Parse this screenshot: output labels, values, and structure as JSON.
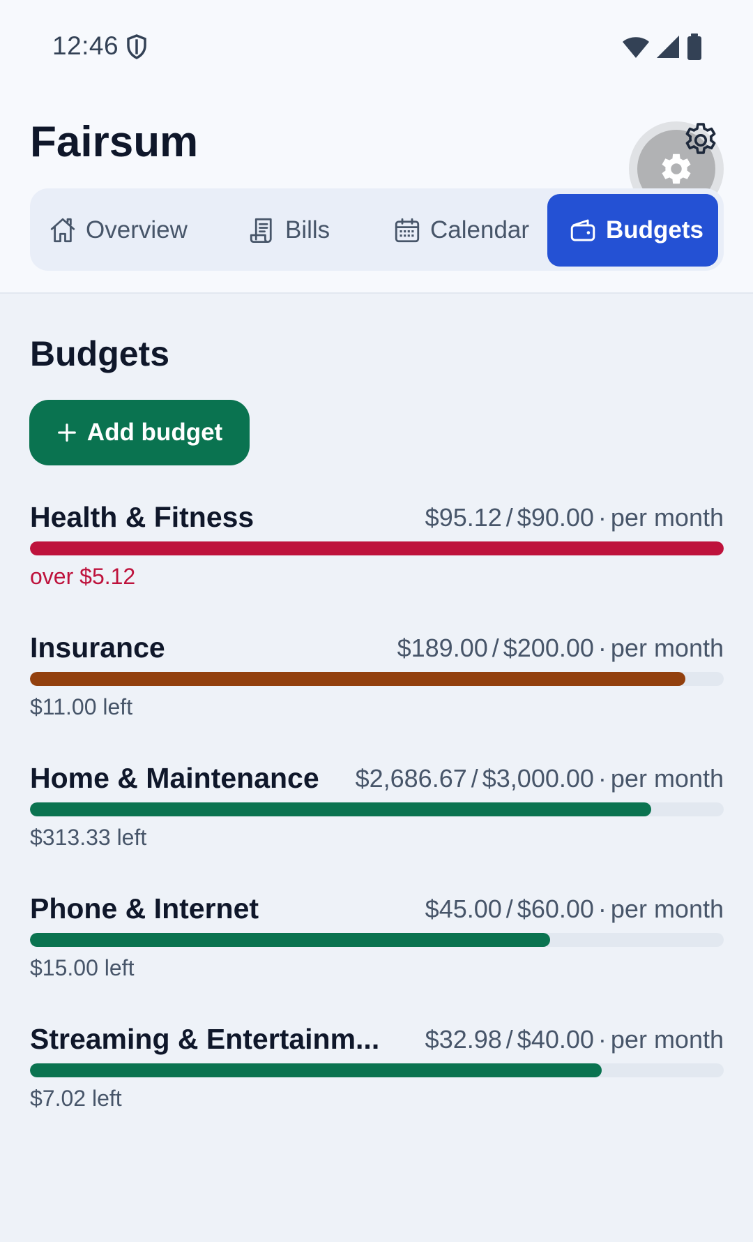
{
  "status_bar": {
    "time": "12:46"
  },
  "app": {
    "title": "Fairsum"
  },
  "tabs": [
    {
      "label": "Overview",
      "icon": "home-icon"
    },
    {
      "label": "Bills",
      "icon": "receipt-icon"
    },
    {
      "label": "Calendar",
      "icon": "calendar-icon"
    },
    {
      "label": "Budgets",
      "icon": "wallet-icon",
      "active": true
    }
  ],
  "budgets_section": {
    "title": "Budgets",
    "add_button_label": "Add budget",
    "items": [
      {
        "name": "Health & Fitness",
        "spent": "$95.12",
        "limit": "$90.00",
        "period": "per month",
        "status": "over $5.12",
        "progress": 1.0,
        "over": true,
        "color": "#be123c"
      },
      {
        "name": "Insurance",
        "spent": "$189.00",
        "limit": "$200.00",
        "period": "per month",
        "status": "$11.00 left",
        "progress": 0.945,
        "over": false,
        "color": "#92400e"
      },
      {
        "name": "Home & Maintenance",
        "spent": "$2,686.67",
        "limit": "$3,000.00",
        "period": "per month",
        "status": "$313.33 left",
        "progress": 0.8956,
        "over": false,
        "color": "#0a7350"
      },
      {
        "name": "Phone & Internet",
        "spent": "$45.00",
        "limit": "$60.00",
        "period": "per month",
        "status": "$15.00 left",
        "progress": 0.75,
        "over": false,
        "color": "#0a7350"
      },
      {
        "name": "Streaming & Entertainm...",
        "spent": "$32.98",
        "limit": "$40.00",
        "period": "per month",
        "status": "$7.02 left",
        "progress": 0.8245,
        "over": false,
        "color": "#0a7350"
      }
    ]
  }
}
